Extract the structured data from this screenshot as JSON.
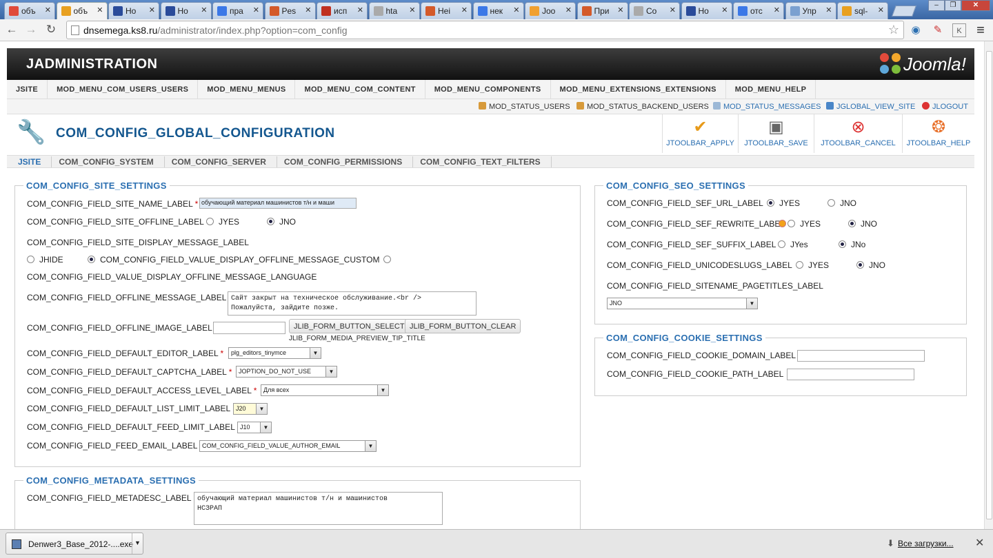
{
  "browser": {
    "tabs": [
      {
        "title": "объ",
        "color": "#e04a3a"
      },
      {
        "title": "объ",
        "color": "#e8a020"
      },
      {
        "title": "Ho",
        "color": "#2a4b9a"
      },
      {
        "title": "Ho",
        "color": "#2a4b9a"
      },
      {
        "title": "пра",
        "color": "#3b78e7"
      },
      {
        "title": "Pes",
        "color": "#d45a2a"
      },
      {
        "title": "исп",
        "color": "#c03020"
      },
      {
        "title": "hta",
        "color": "#aaaaaa"
      },
      {
        "title": "Hei",
        "color": "#d45a2a"
      },
      {
        "title": "нек",
        "color": "#3b78e7"
      },
      {
        "title": "Joo",
        "color": "#f0a030"
      },
      {
        "title": "При",
        "color": "#d45a2a"
      },
      {
        "title": "Co",
        "color": "#aaaaaa"
      },
      {
        "title": "Ho",
        "color": "#2a4b9a"
      },
      {
        "title": "отс",
        "color": "#3b78e7"
      },
      {
        "title": "Упр",
        "color": "#7aa0d0"
      },
      {
        "title": "sql-",
        "color": "#e8a020"
      }
    ],
    "url_host": "dnsemega.ks8.ru",
    "url_path": "/administrator/index.php?option=com_config",
    "back_icon": "←",
    "forward_icon": "→",
    "reload_icon": "↻",
    "star_icon": "☆",
    "menu_icon": "≡"
  },
  "admin": {
    "title": "JADMINISTRATION",
    "logo_text": "Joomla!",
    "menu": [
      "JSITE",
      "MOD_MENU_COM_USERS_USERS",
      "MOD_MENU_MENUS",
      "MOD_MENU_COM_CONTENT",
      "MOD_MENU_COMPONENTS",
      "MOD_MENU_EXTENSIONS_EXTENSIONS",
      "MOD_MENU_HELP"
    ],
    "status": [
      "MOD_STATUS_USERS",
      "MOD_STATUS_BACKEND_USERS",
      "MOD_STATUS_MESSAGES",
      "JGLOBAL_VIEW_SITE",
      "JLOGOUT"
    ]
  },
  "page": {
    "title": "COM_CONFIG_GLOBAL_CONFIGURATION",
    "toolbar": {
      "apply": "JTOOLBAR_APPLY",
      "save": "JTOOLBAR_SAVE",
      "cancel": "JTOOLBAR_CANCEL",
      "help": "JTOOLBAR_HELP"
    },
    "tabs": [
      "JSITE",
      "COM_CONFIG_SYSTEM",
      "COM_CONFIG_SERVER",
      "COM_CONFIG_PERMISSIONS",
      "COM_CONFIG_TEXT_FILTERS"
    ]
  },
  "site": {
    "legend": "COM_CONFIG_SITE_SETTINGS",
    "site_name_label": "COM_CONFIG_FIELD_SITE_NAME_LABEL",
    "site_name_value": "обучающий материал машинистов т/н и маши",
    "offline_label": "COM_CONFIG_FIELD_SITE_OFFLINE_LABEL",
    "yes": "JYES",
    "no": "JNO",
    "display_msg_label": "COM_CONFIG_FIELD_SITE_DISPLAY_MESSAGE_LABEL",
    "hide": "JHIDE",
    "custom": "COM_CONFIG_FIELD_VALUE_DISPLAY_OFFLINE_MESSAGE_CUSTOM",
    "language": "COM_CONFIG_FIELD_VALUE_DISPLAY_OFFLINE_MESSAGE_LANGUAGE",
    "offline_msg_label": "COM_CONFIG_FIELD_OFFLINE_MESSAGE_LABEL",
    "offline_msg_value": "Сайт закрыт на техническое обслуживание.<br />\nПожалуйста, зайдите позже.",
    "offline_image_label": "COM_CONFIG_FIELD_OFFLINE_IMAGE_LABEL",
    "select_btn": "JLIB_FORM_BUTTON_SELECT",
    "clear_btn": "JLIB_FORM_BUTTON_CLEAR",
    "preview_tip": "JLIB_FORM_MEDIA_PREVIEW_TIP_TITLE",
    "editor_label": "COM_CONFIG_FIELD_DEFAULT_EDITOR_LABEL",
    "editor_value": "plg_editors_tinymce",
    "captcha_label": "COM_CONFIG_FIELD_DEFAULT_CAPTCHA_LABEL",
    "captcha_value": "JOPTION_DO_NOT_USE",
    "access_label": "COM_CONFIG_FIELD_DEFAULT_ACCESS_LEVEL_LABEL",
    "access_value": "Для всех",
    "list_limit_label": "COM_CONFIG_FIELD_DEFAULT_LIST_LIMIT_LABEL",
    "list_limit_value": "J20",
    "feed_limit_label": "COM_CONFIG_FIELD_DEFAULT_FEED_LIMIT_LABEL",
    "feed_limit_value": "J10",
    "feed_email_label": "COM_CONFIG_FIELD_FEED_EMAIL_LABEL",
    "feed_email_value": "COM_CONFIG_FIELD_VALUE_AUTHOR_EMAIL",
    "required_mark": "*"
  },
  "metadata": {
    "legend": "COM_CONFIG_METADATA_SETTINGS",
    "desc_label": "COM_CONFIG_FIELD_METADESC_LABEL",
    "desc_value": "обучающий материал машинистов т/н и машинистов\nНСЗРАП"
  },
  "seo": {
    "legend": "COM_CONFIG_SEO_SETTINGS",
    "sef_url_label": "COM_CONFIG_FIELD_SEF_URL_LABEL",
    "sef_rewrite_label": "COM_CONFIG_FIELD_SEF_REWRITE_LABEL",
    "sef_suffix_label": "COM_CONFIG_FIELD_SEF_SUFFIX_LABEL",
    "unicode_label": "COM_CONFIG_FIELD_UNICODESLUGS_LABEL",
    "pagetitles_label": "COM_CONFIG_FIELD_SITENAME_PAGETITLES_LABEL",
    "pagetitles_value": "JNO",
    "yes": "JYES",
    "no": "JNO",
    "yes_mixed": "JYes",
    "no_mixed": "JNo"
  },
  "cookie": {
    "legend": "COM_CONFIG_COOKIE_SETTINGS",
    "domain_label": "COM_CONFIG_FIELD_COOKIE_DOMAIN_LABEL",
    "path_label": "COM_CONFIG_FIELD_COOKIE_PATH_LABEL"
  },
  "downloads": {
    "file": "Denwer3_Base_2012-....exe",
    "all": "Все загрузки...",
    "close_icon": "✕"
  }
}
